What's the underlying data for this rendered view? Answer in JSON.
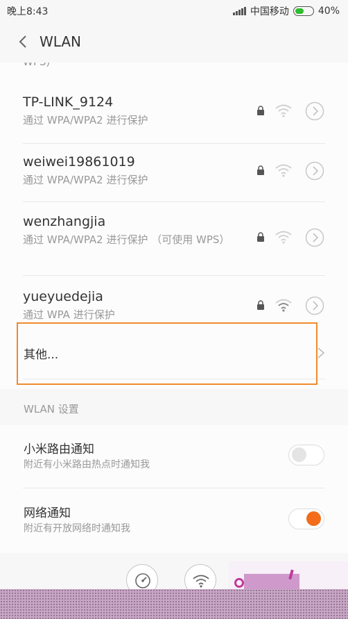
{
  "status_bar": {
    "time": "晚上8:43",
    "carrier": "中国移动",
    "battery": "40%",
    "battery_level": 0.4,
    "icons": [
      "signal-bars-icon",
      "battery-icon"
    ]
  },
  "header": {
    "title": "WLAN",
    "back_icon": "chevron-left-icon"
  },
  "networks": {
    "cut_text": "WPS)",
    "items": [
      {
        "ssid": "TP-LINK_9124",
        "security": "通过 WPA/WPA2 进行保护"
      },
      {
        "ssid": "weiwei19861019",
        "security": "通过 WPA/WPA2 进行保护"
      },
      {
        "ssid": "wenzhangjia",
        "security": "通过 WPA/WPA2 进行保护 （可使用 WPS）"
      },
      {
        "ssid": "yueyuedejia",
        "security": "通过 WPA 进行保护"
      }
    ],
    "other": "其他..."
  },
  "settings": {
    "section_title": "WLAN 设置",
    "items": [
      {
        "title": "小米路由通知",
        "subtitle": "附近有小米路由热点时通知我",
        "enabled": false
      },
      {
        "title": "网络通知",
        "subtitle": "附近有开放网络时通知我",
        "enabled": true
      }
    ]
  },
  "bottom_bar": {
    "icons": [
      "speed-test-icon",
      "wifi-icon"
    ]
  },
  "colors": {
    "accent": "#f36c1a",
    "highlight_border": "#f08a2c",
    "background": "#f7f7f7",
    "secondary_text": "#999999"
  }
}
